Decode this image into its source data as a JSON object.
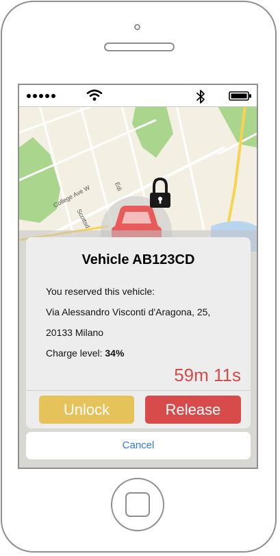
{
  "status_bar": {
    "signal_icon": "signal-dots-icon",
    "wifi_icon": "wifi-icon",
    "bluetooth_icon": "bluetooth-icon",
    "battery_icon": "battery-icon"
  },
  "map": {
    "street_labels": [
      "College Ave W",
      "Scottsd",
      "Edi"
    ],
    "car_marker_icon": "car-icon",
    "lock_icon": "lock-icon",
    "car_color": "#e85b5b",
    "lock_color": "#1a1a1a"
  },
  "dialog": {
    "title": "Vehicle AB123CD",
    "reserved_text": "You reserved this vehicle:",
    "address_line1": "Via Alessandro Visconti d'Aragona, 25,",
    "address_line2": "20133 Milano",
    "charge_label": "Charge level:",
    "charge_value": "34%",
    "timer": "59m 11s",
    "unlock_label": "Unlock",
    "release_label": "Release",
    "cancel_label": "Cancel"
  },
  "colors": {
    "unlock": "#e6c35a",
    "release": "#d74b4b",
    "timer": "#d64a49",
    "cancel": "#2f7ae5"
  }
}
